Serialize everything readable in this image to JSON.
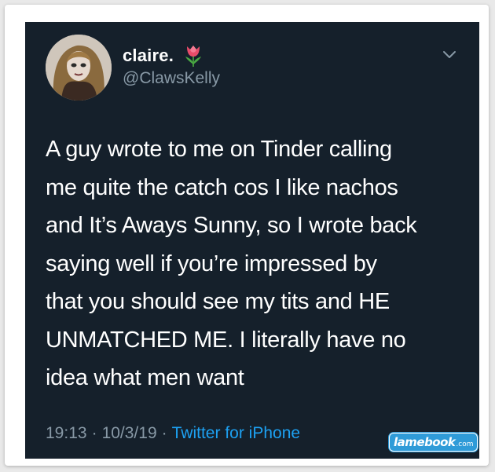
{
  "tweet": {
    "display_name": "claire.",
    "name_emoji": "tulip-icon",
    "handle": "@ClawsKelly",
    "text": "A guy wrote to me on Tinder calling me quite the catch cos I like nachos and It’s Aways Sunny, so I wrote back saying well if you’re impressed by that you should see my tits and HE UNMATCHED ME. I literally have no idea what men want",
    "lines": [
      "A guy wrote to me on Tinder calling",
      "me quite the catch cos I like nachos",
      "and It’s Aways Sunny, so I wrote back",
      "saying well if you’re impressed by",
      "that you should see my tits and HE",
      "UNMATCHED ME. I literally have no",
      "idea what men want"
    ],
    "time": "19:13",
    "date": "10/3/19",
    "separator": "·",
    "source": "Twitter for iPhone"
  },
  "watermark": {
    "brand": "lamebook",
    "tld": ".com"
  },
  "colors": {
    "background": "#15202b",
    "text": "#ffffff",
    "secondary": "#8899a6",
    "link": "#1da1f2",
    "watermark": "#2f9bd8"
  }
}
